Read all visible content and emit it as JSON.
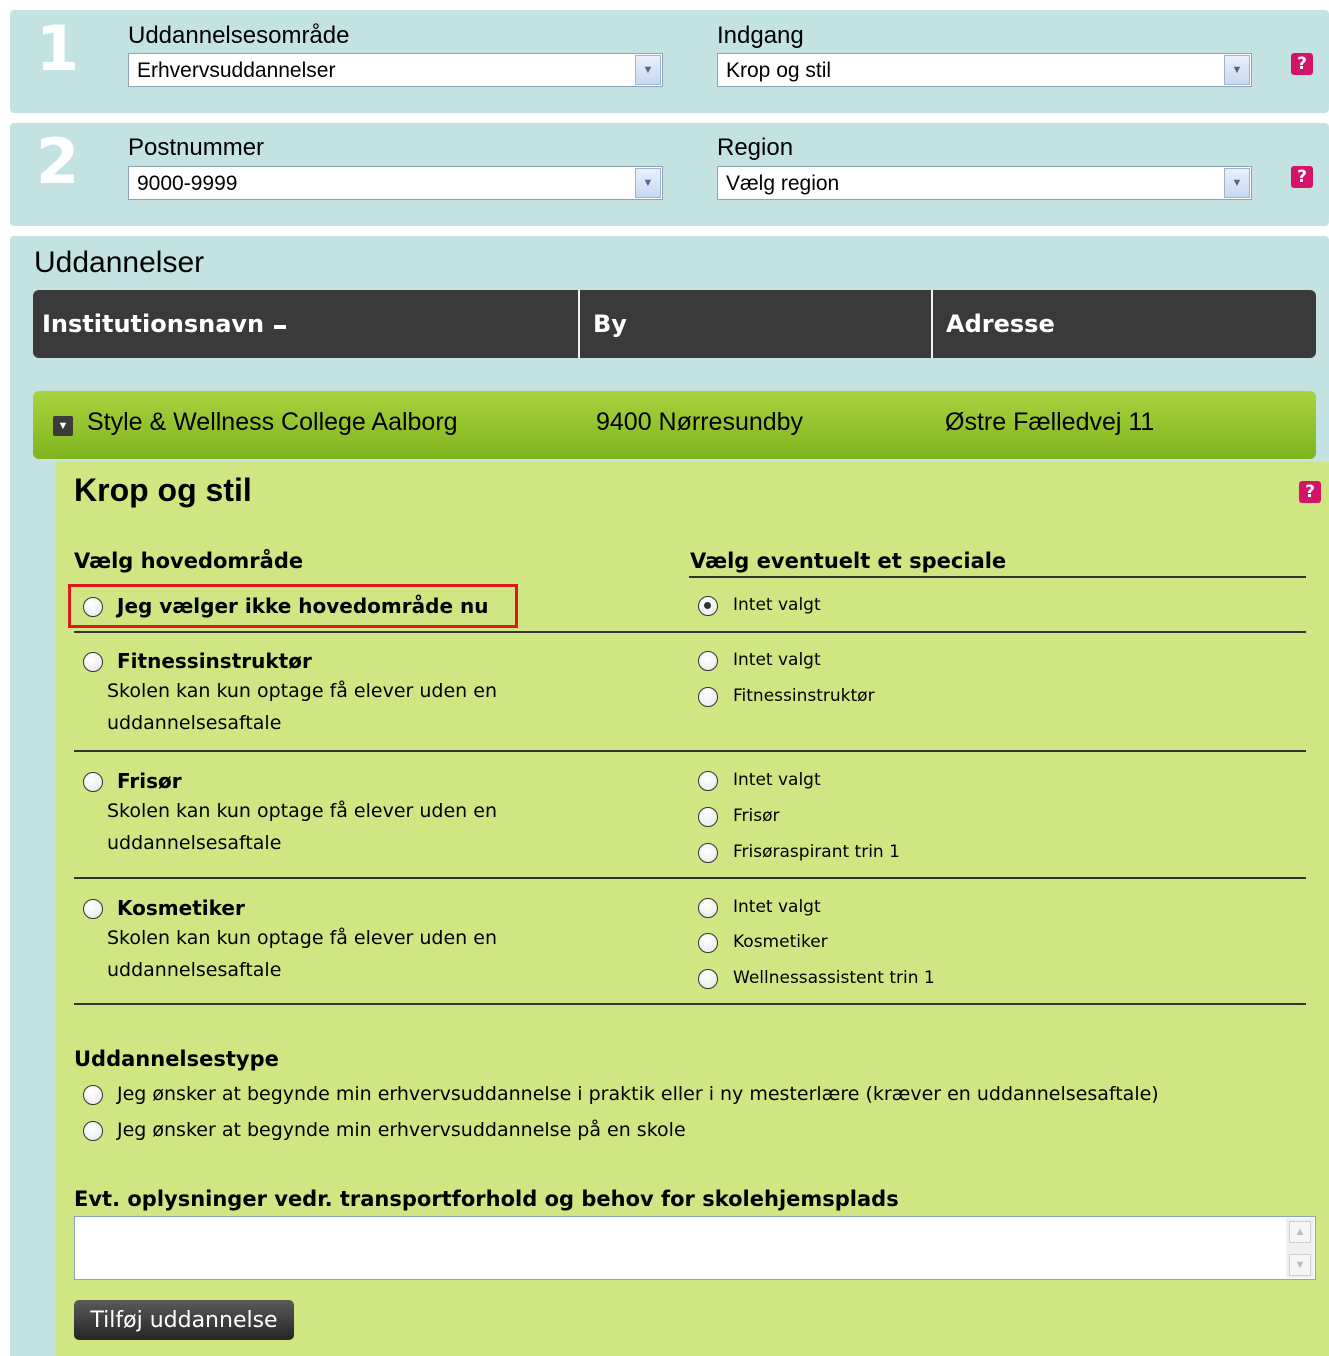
{
  "step1": {
    "number": "1",
    "area_label": "Uddannelsesområde",
    "area_value": "Erhvervsuddannelser",
    "entry_label": "Indgang",
    "entry_value": "Krop og stil"
  },
  "step2": {
    "number": "2",
    "postal_label": "Postnummer",
    "postal_value": "9000-9999",
    "region_label": "Region",
    "region_value": "Vælg region"
  },
  "help_glyph": "?",
  "education": {
    "title": "Uddannelser",
    "columns": [
      "Institutionsnavn",
      "By",
      "Adresse"
    ],
    "institution": {
      "name": "Style & Wellness College Aalborg",
      "city": "9400 Nørresundby",
      "address": "Østre Fælledvej 11"
    }
  },
  "panel": {
    "title": "Krop og stil",
    "main_heading": "Vælg hovedområde",
    "special_heading": "Vælg eventuelt et speciale",
    "groups": [
      {
        "main": "Jeg vælger ikke hovedområde nu",
        "note_line1": "",
        "note_line2": "",
        "specials": [
          "Intet valgt"
        ]
      },
      {
        "main": "Fitnessinstruktør",
        "note_line1": "Skolen kan kun optage få elever uden en",
        "note_line2": "uddannelsesaftale",
        "specials": [
          "Intet valgt",
          "Fitnessinstruktør"
        ]
      },
      {
        "main": "Frisør",
        "note_line1": "Skolen kan kun optage få elever uden en",
        "note_line2": "uddannelsesaftale",
        "specials": [
          "Intet valgt",
          "Frisør",
          "Frisøraspirant trin 1"
        ]
      },
      {
        "main": "Kosmetiker",
        "note_line1": "Skolen kan kun optage få elever uden en",
        "note_line2": "uddannelsesaftale",
        "specials": [
          "Intet valgt",
          "Kosmetiker",
          "Wellnessassistent trin 1"
        ]
      }
    ],
    "type_heading": "Uddannelsestype",
    "type_options": [
      "Jeg ønsker at begynde min erhvervsuddannelse i praktik eller i ny mesterlære (kræver en uddannelsesaftale)",
      "Jeg ønsker at begynde min erhvervsuddannelse på en skole"
    ],
    "transport_heading": "Evt. oplysninger vedr. transportforhold og behov for skolehjemsplads",
    "transport_value": "",
    "add_button": "Tilføj uddannelse"
  }
}
